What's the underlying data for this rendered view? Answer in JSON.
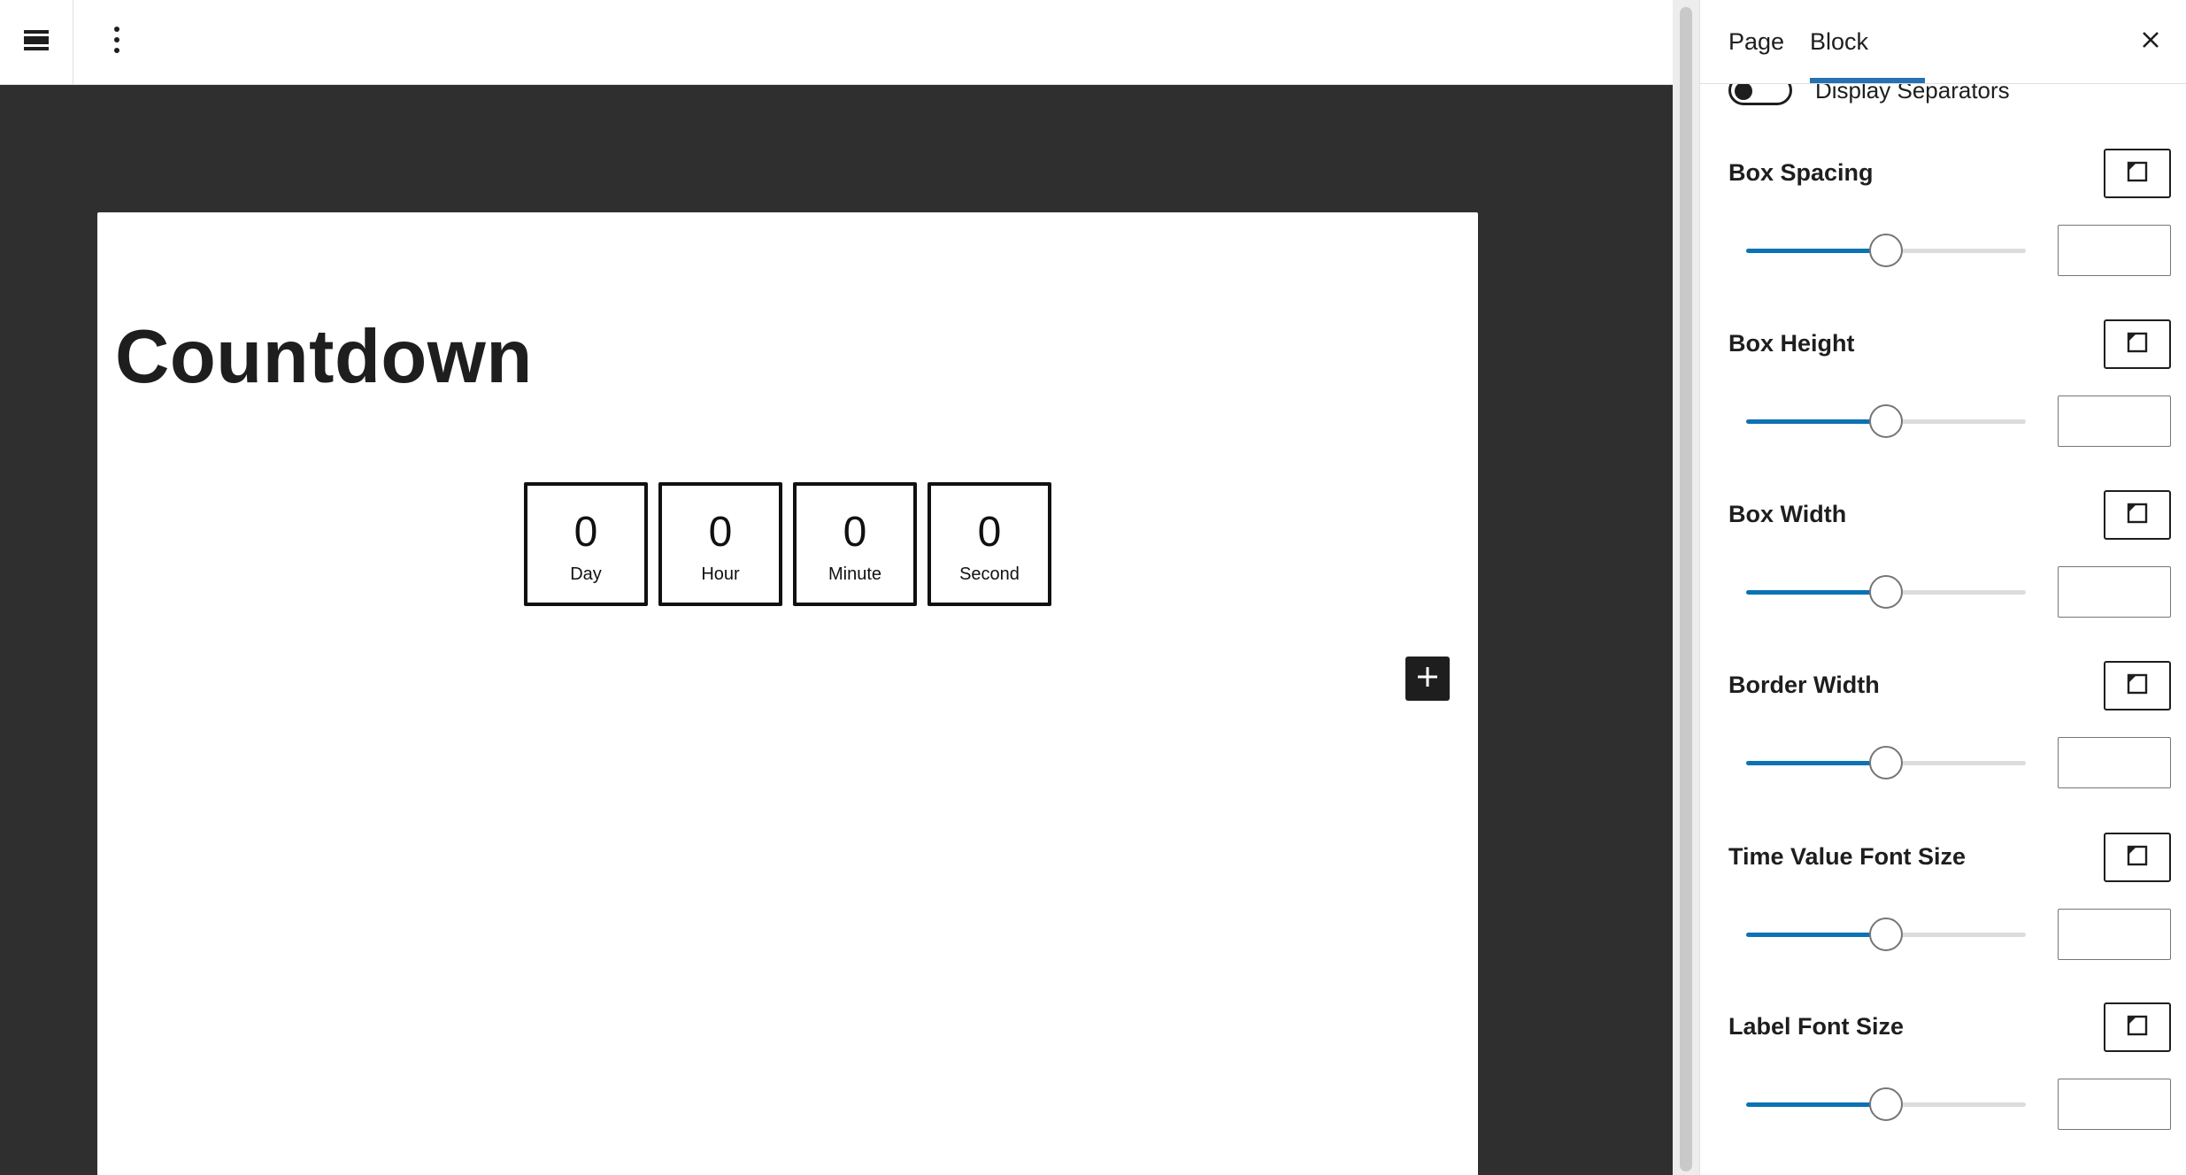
{
  "editor": {
    "title": "Countdown",
    "countdown": [
      {
        "value": "0",
        "label": "Day"
      },
      {
        "value": "0",
        "label": "Hour"
      },
      {
        "value": "0",
        "label": "Minute"
      },
      {
        "value": "0",
        "label": "Second"
      }
    ]
  },
  "sidebar": {
    "tabs": [
      {
        "label": "Page",
        "active": false
      },
      {
        "label": "Block",
        "active": true
      }
    ],
    "toggle": {
      "label": "Display Separators",
      "checked": false
    },
    "controls": [
      {
        "label": "Box Spacing",
        "value": "",
        "level": 0.5
      },
      {
        "label": "Box Height",
        "value": "",
        "level": 0.5
      },
      {
        "label": "Box Width",
        "value": "",
        "level": 0.5
      },
      {
        "label": "Border Width",
        "value": "",
        "level": 0.5
      },
      {
        "label": "Time Value Font Size",
        "value": "",
        "level": 0.5
      },
      {
        "label": "Label Font Size",
        "value": "",
        "level": 0.5
      }
    ]
  },
  "colors": {
    "accent": "#0b72b5",
    "canvas_bg": "#2f2f2f",
    "text": "#1e1e1e"
  },
  "icons": {
    "menu": "menu-icon",
    "more": "more-vertical-icon",
    "close": "close-icon",
    "add": "plus-icon",
    "unit": "custom-unit-icon"
  }
}
